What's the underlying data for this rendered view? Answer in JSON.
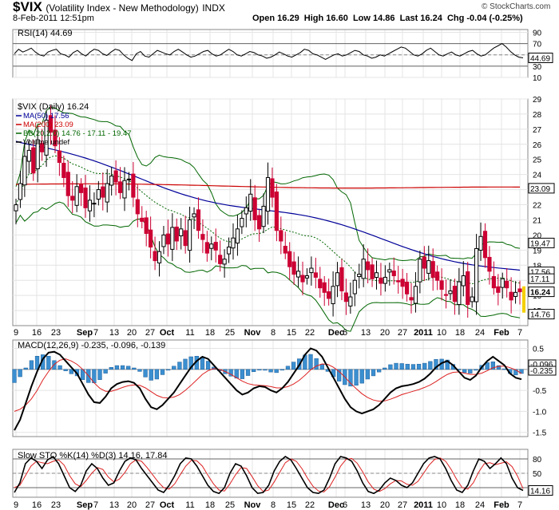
{
  "header": {
    "symbol": "$VIX",
    "name": "(Volatility Index - New Methodology)",
    "exchange": "INDX",
    "date": "8-Feb-2011 12:51pm",
    "ohlc": "Open 16.29  High 16.60  Low 14.86  Last 16.24  Chg -0.04 (-0.25%)",
    "watermark": "© StockCharts.com"
  },
  "colors": {
    "price_up": "#000000",
    "price_down": "#cc0033",
    "ma50": "#000099",
    "ma200": "#cc0000",
    "bb": "#006600",
    "hist": "#3b8fd0",
    "volume": "#9fc3e6",
    "highlight": "#f5d000"
  },
  "x_axis_labels": [
    "9",
    "16",
    "23",
    "Sep",
    "7",
    "13",
    "20",
    "27",
    "Oct",
    "11",
    "18",
    "25",
    "Nov",
    "8",
    "15",
    "22",
    "Dec",
    "6",
    "13",
    "20",
    "27",
    "2011",
    "10",
    "18",
    "24",
    "Feb",
    "7"
  ],
  "chart_data": [
    {
      "panel": "rsi",
      "type": "line",
      "title": "RSI(14) 44.69",
      "ylim": [
        10,
        95
      ],
      "yticks": [
        10,
        30,
        50,
        70,
        90
      ],
      "reference_lines": [
        30,
        70
      ],
      "last_value": 44.69,
      "values": [
        52,
        60,
        55,
        58,
        62,
        55,
        50,
        48,
        55,
        58,
        60,
        52,
        50,
        46,
        54,
        58,
        52,
        48,
        55,
        60,
        58,
        52,
        49,
        55,
        60,
        58,
        50,
        44,
        40,
        52,
        56,
        48,
        46,
        52,
        58,
        55,
        52,
        50,
        56,
        60,
        55,
        50,
        46,
        48,
        52,
        56,
        58,
        52,
        48,
        50,
        55,
        60,
        56,
        50,
        48,
        52,
        56,
        54,
        50,
        48,
        44,
        46,
        50,
        55,
        52,
        48,
        46,
        50,
        54,
        60,
        58,
        52,
        50,
        46,
        42,
        46,
        50,
        52,
        48,
        50,
        54,
        58,
        56,
        50,
        48,
        44,
        46,
        50,
        48,
        52,
        56,
        60,
        64,
        62,
        56,
        50,
        48,
        52,
        58,
        62,
        56,
        50,
        48,
        52,
        55,
        50,
        48,
        52,
        56,
        58,
        52,
        48,
        50,
        56,
        62,
        66,
        70,
        64,
        56,
        50,
        46,
        44.69
      ]
    },
    {
      "panel": "price",
      "type": "candlestick",
      "title": "$VIX (Daily) 16.24",
      "legend": [
        "MA(50) 17.56",
        "MA(200) 23.09",
        "BB(20,2.0) 14.76 - 17.11 - 19.47",
        "Volume undef"
      ],
      "ylim": [
        14,
        29
      ],
      "yticks": [
        15,
        16,
        17,
        18,
        19,
        20,
        21,
        22,
        23,
        24,
        25,
        26,
        27,
        28,
        29
      ],
      "price_labels": [
        {
          "v": 23.09,
          "t": "23.09"
        },
        {
          "v": 19.47,
          "t": "19.47"
        },
        {
          "v": 17.56,
          "t": "17.56"
        },
        {
          "v": 17.11,
          "t": "17.11"
        },
        {
          "v": 16.24,
          "t": "16.24"
        },
        {
          "v": 14.76,
          "t": "14.76"
        }
      ],
      "close": [
        22.0,
        23.4,
        25.2,
        25.6,
        24.1,
        26.3,
        25.5,
        27.6,
        26.8,
        25.9,
        24.8,
        23.8,
        22.6,
        22.3,
        23.2,
        22.8,
        21.8,
        22.3,
        22.1,
        23.0,
        22.5,
        23.4,
        23.9,
        23.5,
        22.8,
        23.6,
        23.7,
        22.5,
        21.4,
        20.9,
        20.1,
        19.2,
        18.3,
        18.9,
        20.0,
        19.4,
        20.5,
        19.6,
        20.4,
        19.3,
        21.0,
        21.4,
        20.3,
        19.7,
        18.8,
        19.4,
        19.0,
        18.1,
        18.4,
        19.2,
        19.8,
        20.4,
        21.1,
        21.8,
        22.7,
        21.0,
        20.4,
        21.9,
        23.8,
        22.5,
        20.3,
        19.6,
        18.8,
        17.9,
        17.4,
        17.6,
        16.9,
        17.3,
        17.8,
        17.2,
        16.5,
        16.2,
        15.8,
        16.6,
        17.5,
        16.3,
        15.6,
        15.9,
        17.0,
        17.4,
        18.4,
        17.7,
        17.1,
        17.5,
        16.8,
        17.2,
        17.7,
        17.3,
        16.9,
        16.6,
        16.1,
        15.7,
        16.6,
        18.4,
        17.8,
        18.3,
        17.2,
        17.0,
        16.4,
        16.0,
        16.3,
        15.6,
        16.9,
        17.3,
        15.4,
        15.9,
        19.1,
        19.9,
        18.5,
        17.6,
        16.5,
        16.2,
        17.1,
        16.5,
        15.7,
        16.2,
        16.24
      ]
    },
    {
      "panel": "macd",
      "type": "line",
      "title": "MACD(12,26,9) -0.235, -0.096, -0.139",
      "ylim": [
        -1.6,
        0.7
      ],
      "yticks": [
        0.5,
        0.0,
        -0.5,
        -1.0,
        -1.5
      ],
      "value_labels": [
        "-0.096",
        "-0.235"
      ],
      "macd": [
        -1.45,
        -1.2,
        -0.8,
        -0.4,
        -0.05,
        0.25,
        0.4,
        0.42,
        0.35,
        0.2,
        0.05,
        -0.1,
        -0.35,
        -0.6,
        -0.78,
        -0.8,
        -0.65,
        -0.45,
        -0.35,
        -0.3,
        -0.28,
        -0.32,
        -0.45,
        -0.7,
        -0.9,
        -0.95,
        -0.85,
        -0.7,
        -0.55,
        -0.35,
        -0.15,
        0.05,
        0.2,
        0.3,
        0.25,
        0.1,
        -0.05,
        -0.2,
        -0.35,
        -0.5,
        -0.6,
        -0.55,
        -0.45,
        -0.4,
        -0.42,
        -0.5,
        -0.55,
        -0.45,
        -0.3,
        -0.1,
        0.1,
        0.35,
        0.5,
        0.45,
        0.3,
        0.05,
        -0.2,
        -0.45,
        -0.7,
        -0.9,
        -1.0,
        -1.05,
        -1.0,
        -0.95,
        -0.85,
        -0.7,
        -0.55,
        -0.45,
        -0.4,
        -0.38,
        -0.35,
        -0.3,
        -0.22,
        -0.1,
        0.05,
        0.15,
        0.2,
        0.1,
        -0.05,
        -0.2,
        -0.25,
        -0.15,
        0.05,
        0.2,
        0.3,
        0.2,
        0.1,
        -0.1,
        -0.2,
        -0.235
      ],
      "signal": [
        -1.0,
        -0.95,
        -0.85,
        -0.7,
        -0.5,
        -0.25,
        -0.05,
        0.12,
        0.22,
        0.25,
        0.2,
        0.12,
        0.0,
        -0.15,
        -0.32,
        -0.45,
        -0.52,
        -0.52,
        -0.48,
        -0.43,
        -0.39,
        -0.37,
        -0.38,
        -0.44,
        -0.53,
        -0.62,
        -0.67,
        -0.68,
        -0.66,
        -0.6,
        -0.5,
        -0.38,
        -0.25,
        -0.12,
        -0.03,
        0.02,
        0.0,
        -0.05,
        -0.12,
        -0.2,
        -0.28,
        -0.34,
        -0.37,
        -0.38,
        -0.39,
        -0.41,
        -0.44,
        -0.44,
        -0.41,
        -0.35,
        -0.26,
        -0.14,
        -0.01,
        0.08,
        0.13,
        0.12,
        0.05,
        -0.05,
        -0.18,
        -0.33,
        -0.46,
        -0.58,
        -0.67,
        -0.73,
        -0.76,
        -0.75,
        -0.71,
        -0.66,
        -0.6,
        -0.56,
        -0.52,
        -0.48,
        -0.43,
        -0.37,
        -0.29,
        -0.2,
        -0.12,
        -0.07,
        -0.06,
        -0.09,
        -0.12,
        -0.12,
        -0.09,
        -0.03,
        0.04,
        0.07,
        0.08,
        0.04,
        -0.01,
        -0.096
      ]
    },
    {
      "panel": "sto",
      "type": "line",
      "title": "Slow STO %K(14) %D(3) 14.16, 17.84",
      "ylim": [
        0,
        100
      ],
      "yticks": [
        20,
        50,
        80
      ],
      "reference_lines": [
        20,
        80
      ],
      "value_label": "14.16",
      "k": [
        10,
        30,
        70,
        82,
        75,
        60,
        78,
        85,
        70,
        45,
        20,
        12,
        25,
        55,
        70,
        60,
        40,
        25,
        30,
        55,
        75,
        82,
        78,
        60,
        45,
        30,
        15,
        10,
        25,
        45,
        70,
        82,
        80,
        65,
        45,
        25,
        12,
        8,
        20,
        50,
        70,
        65,
        45,
        20,
        8,
        10,
        25,
        55,
        75,
        85,
        78,
        60,
        40,
        20,
        10,
        8,
        15,
        40,
        70,
        85,
        82,
        75,
        55,
        30,
        12,
        8,
        15,
        30,
        40,
        35,
        25,
        20,
        30,
        50,
        70,
        82,
        85,
        80,
        60,
        35,
        15,
        10,
        25,
        55,
        80,
        75,
        60,
        70,
        82,
        70,
        40,
        20,
        14.16
      ],
      "d": [
        20,
        25,
        45,
        65,
        75,
        72,
        70,
        75,
        78,
        67,
        45,
        28,
        22,
        35,
        50,
        62,
        58,
        42,
        32,
        38,
        52,
        70,
        78,
        75,
        62,
        47,
        32,
        20,
        17,
        28,
        47,
        65,
        77,
        76,
        65,
        46,
        28,
        15,
        13,
        28,
        47,
        62,
        60,
        43,
        24,
        12,
        15,
        32,
        52,
        72,
        80,
        75,
        60,
        40,
        23,
        13,
        11,
        22,
        42,
        65,
        79,
        81,
        71,
        53,
        32,
        17,
        12,
        18,
        28,
        35,
        34,
        27,
        25,
        33,
        50,
        67,
        79,
        82,
        75,
        58,
        37,
        20,
        17,
        30,
        53,
        70,
        72,
        68,
        71,
        74,
        64,
        44,
        17.84
      ]
    }
  ]
}
